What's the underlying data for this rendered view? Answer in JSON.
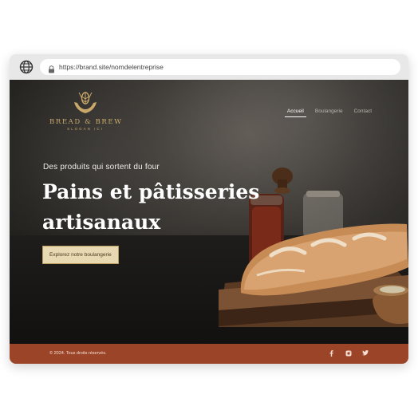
{
  "browser": {
    "url": "https://brand.site/nomdelentreprise",
    "icons": [
      "globe-icon",
      "lock-icon"
    ]
  },
  "brand": {
    "name": "BREAD & BREW",
    "slogan": "SLOGAN ICI",
    "logo_color": "#c9a96a"
  },
  "nav": {
    "items": [
      {
        "label": "Accueil",
        "active": true
      },
      {
        "label": "Boulangerie",
        "active": false
      },
      {
        "label": "Contact",
        "active": false
      }
    ]
  },
  "hero": {
    "subtitle": "Des produits qui sortent du four",
    "title": "Pains et pâtisseries artisanaux",
    "cta_label": "Explorez notre boulangerie",
    "cta_color": "#e9d9b2"
  },
  "footer": {
    "copyright": "© 2024. Tous droits réservés.",
    "color": "#9c4428",
    "socials": [
      "facebook-icon",
      "instagram-icon",
      "twitter-icon"
    ]
  }
}
